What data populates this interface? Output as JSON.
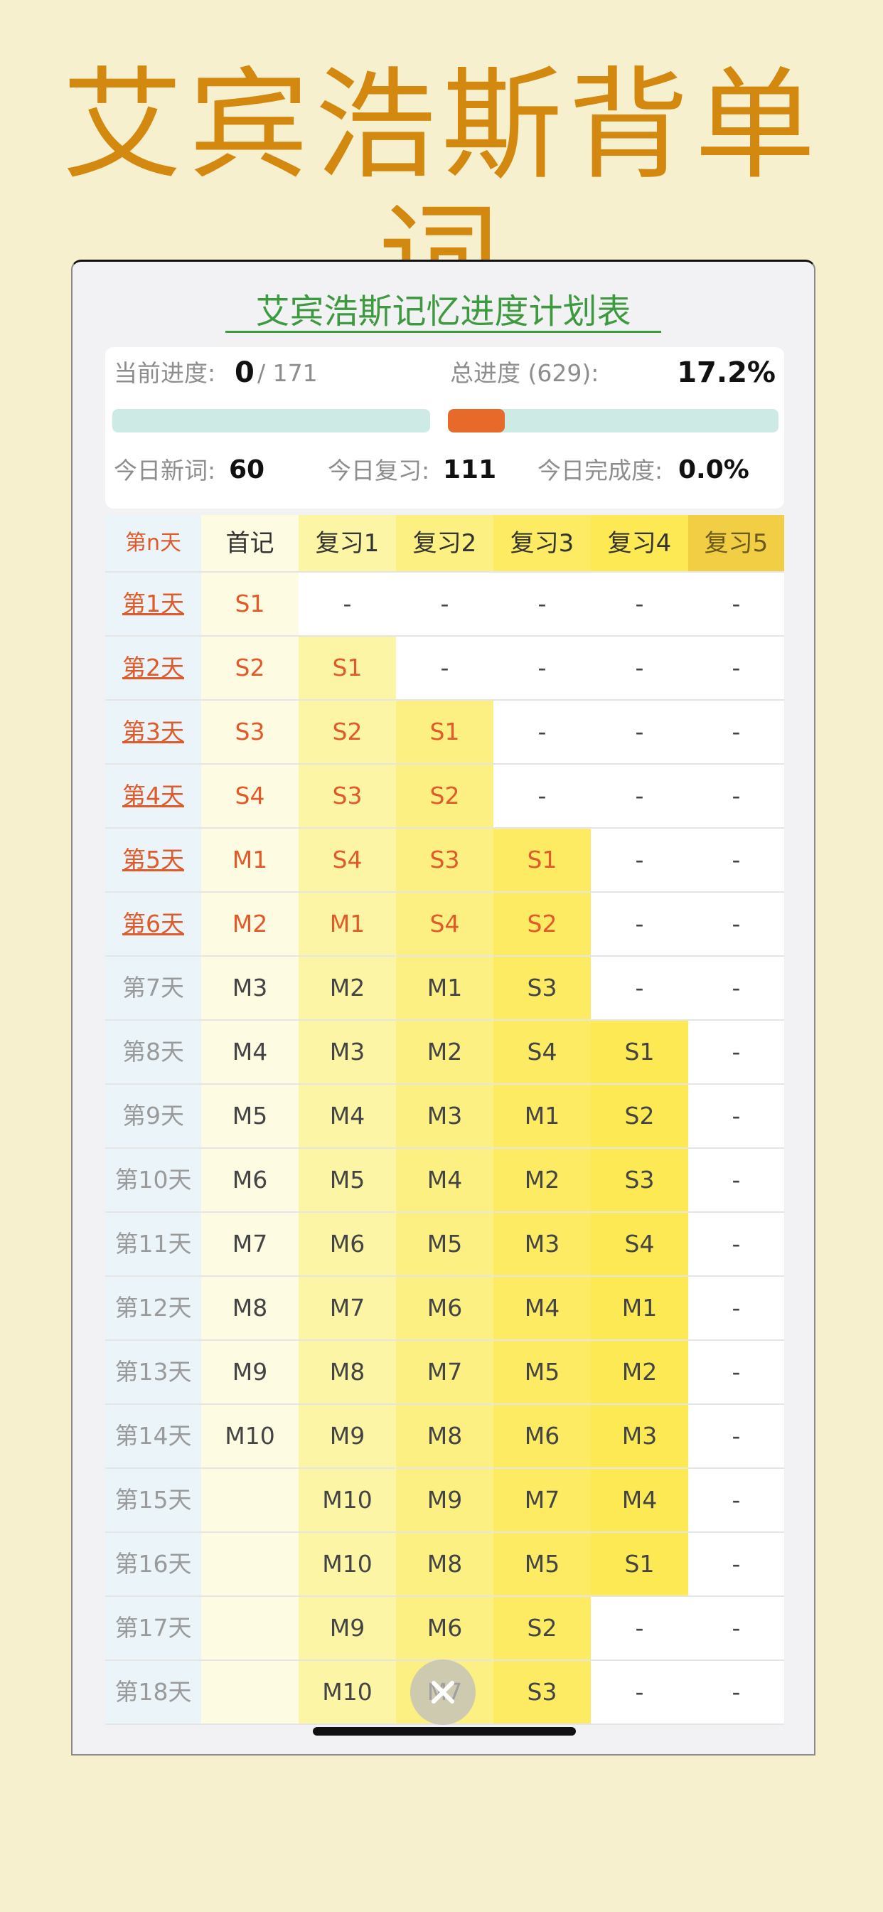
{
  "headline": "艾宾浩斯背单词",
  "panel_title": "艾宾浩斯记忆进度计划表",
  "stats": {
    "current_label": "当前进度:",
    "current_value": "0",
    "current_total": "/ 171",
    "current_fraction": 0.0,
    "overall_label": "总进度 (629):",
    "overall_value": "17.2%",
    "overall_fraction": 0.172,
    "new_label": "今日新词:",
    "new_value": "60",
    "review_label": "今日复习:",
    "review_value": "111",
    "done_label": "今日完成度:",
    "done_value": "0.0%"
  },
  "table": {
    "headers": [
      "第n天",
      "首记",
      "复习1",
      "复习2",
      "复习3",
      "复习4",
      "复习5"
    ],
    "rows": [
      {
        "day": "第1天",
        "cells": [
          "S1",
          "-",
          "-",
          "-",
          "-",
          "-"
        ],
        "active": true
      },
      {
        "day": "第2天",
        "cells": [
          "S2",
          "S1",
          "-",
          "-",
          "-",
          "-"
        ],
        "active": true
      },
      {
        "day": "第3天",
        "cells": [
          "S3",
          "S2",
          "S1",
          "-",
          "-",
          "-"
        ],
        "active": true
      },
      {
        "day": "第4天",
        "cells": [
          "S4",
          "S3",
          "S2",
          "-",
          "-",
          "-"
        ],
        "active": true
      },
      {
        "day": "第5天",
        "cells": [
          "M1",
          "S4",
          "S3",
          "S1",
          "-",
          "-"
        ],
        "active": true
      },
      {
        "day": "第6天",
        "cells": [
          "M2",
          "M1",
          "S4",
          "S2",
          "-",
          "-"
        ],
        "active": true
      },
      {
        "day": "第7天",
        "cells": [
          "M3",
          "M2",
          "M1",
          "S3",
          "-",
          "-"
        ],
        "active": false
      },
      {
        "day": "第8天",
        "cells": [
          "M4",
          "M3",
          "M2",
          "S4",
          "S1",
          "-"
        ],
        "active": false
      },
      {
        "day": "第9天",
        "cells": [
          "M5",
          "M4",
          "M3",
          "M1",
          "S2",
          "-"
        ],
        "active": false
      },
      {
        "day": "第10天",
        "cells": [
          "M6",
          "M5",
          "M4",
          "M2",
          "S3",
          "-"
        ],
        "active": false
      },
      {
        "day": "第11天",
        "cells": [
          "M7",
          "M6",
          "M5",
          "M3",
          "S4",
          "-"
        ],
        "active": false
      },
      {
        "day": "第12天",
        "cells": [
          "M8",
          "M7",
          "M6",
          "M4",
          "M1",
          "-"
        ],
        "active": false
      },
      {
        "day": "第13天",
        "cells": [
          "M9",
          "M8",
          "M7",
          "M5",
          "M2",
          "-"
        ],
        "active": false
      },
      {
        "day": "第14天",
        "cells": [
          "M10",
          "M9",
          "M8",
          "M6",
          "M3",
          "-"
        ],
        "active": false
      },
      {
        "day": "第15天",
        "cells": [
          "",
          "M10",
          "M9",
          "M7",
          "M4",
          "-"
        ],
        "active": false
      },
      {
        "day": "第16天",
        "cells": [
          "",
          "M10",
          "M8",
          "M5",
          "S1",
          "-"
        ],
        "active": false
      },
      {
        "day": "第17天",
        "cells": [
          "",
          "M9",
          "M6",
          "S2",
          "-",
          "-"
        ],
        "active": false
      },
      {
        "day": "第18天",
        "cells": [
          "",
          "M10",
          "M7",
          "S3",
          "-",
          "-"
        ],
        "active": false
      }
    ]
  },
  "colors": {
    "active_day": "#e05a2a",
    "inactive_day": "#9a9a9a",
    "progress_bar": "#e86a2b",
    "bar_track": "#cdeae5",
    "headline": "#d3890f",
    "panel_title": "#3d9a3f"
  },
  "close_icon": "close-icon"
}
